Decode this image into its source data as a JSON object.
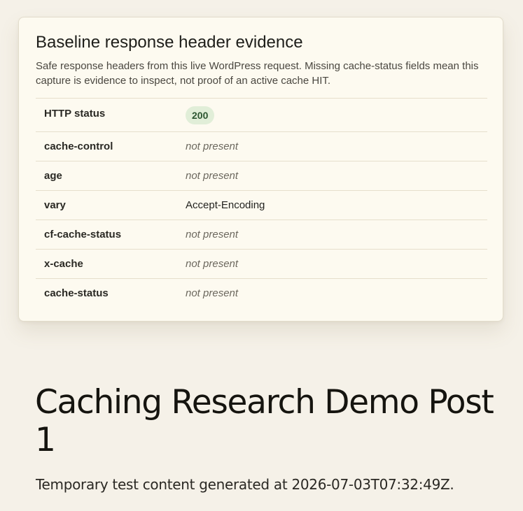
{
  "evidence": {
    "title": "Baseline response header evidence",
    "description": "Safe response headers from this live WordPress request. Missing cache-status fields mean this capture is evidence to inspect, not proof of an active cache HIT.",
    "status": {
      "label": "HTTP status",
      "value": "200",
      "badge_bg": "#e1eed8",
      "badge_fg": "#2c5630"
    },
    "rows": [
      {
        "key": "cache-control",
        "value": "not present"
      },
      {
        "key": "age",
        "value": "not present"
      },
      {
        "key": "vary",
        "value": "Accept-Encoding"
      },
      {
        "key": "cf-cache-status",
        "value": "not present"
      },
      {
        "key": "x-cache",
        "value": "not present"
      },
      {
        "key": "cache-status",
        "value": "not present"
      }
    ]
  },
  "post": {
    "title": "Caching Research Demo Post 1",
    "excerpt": "Temporary test content generated at 2026-07-03T07:32:49Z."
  },
  "colors": {
    "page_bg": "#f5f1e8",
    "card_bg": "#fdfaf0"
  }
}
